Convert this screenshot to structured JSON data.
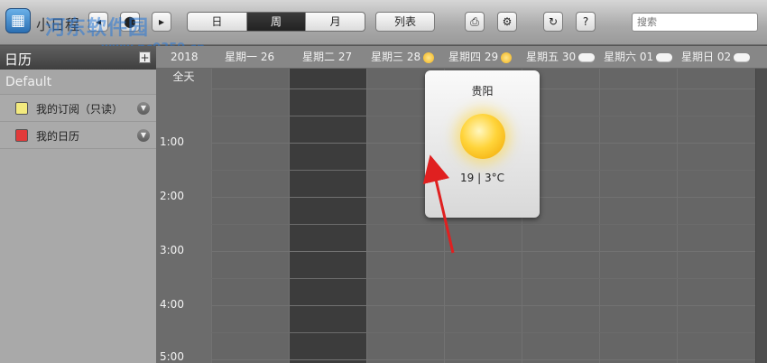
{
  "app": {
    "title": "小日程",
    "logo_icon": "calendar-logo-icon"
  },
  "toolbar": {
    "nav_buttons": [
      "back-icon",
      "location-pin-icon",
      "forward-icon"
    ],
    "views": [
      {
        "label": "日",
        "active": false
      },
      {
        "label": "周",
        "active": true
      },
      {
        "label": "月",
        "active": false
      }
    ],
    "list_label": "列表",
    "print_icon": "printer-icon",
    "settings_icon": "gear-icon",
    "sync_icon": "refresh-icon",
    "help_label": "?",
    "search_placeholder": "搜索"
  },
  "watermark": {
    "text": "河东软件园",
    "url": "www.pc0359.cn"
  },
  "sidebar": {
    "title": "日历",
    "add_label": "+",
    "section": "Default",
    "calendars": [
      {
        "label": "我的订阅（只读）",
        "color": "#f3ea7e"
      },
      {
        "label": "我的日历",
        "color": "#e23a3a"
      }
    ]
  },
  "calendar": {
    "year": "2018",
    "days": [
      {
        "label": "星期一 26",
        "weather": ""
      },
      {
        "label": "星期二 27",
        "weather": "",
        "today": true
      },
      {
        "label": "星期三 28",
        "weather": "sun-icon"
      },
      {
        "label": "星期四 29",
        "weather": "sun-icon"
      },
      {
        "label": "星期五 30",
        "weather": "cloud-icon"
      },
      {
        "label": "星期六 01",
        "weather": "cloud-icon"
      },
      {
        "label": "星期日 02",
        "weather": "cloud-icon"
      }
    ],
    "allday_label": "全天",
    "times": [
      "1:00",
      "2:00",
      "3:00",
      "4:00",
      "5:00"
    ]
  },
  "weather_popup": {
    "city": "贵阳",
    "icon": "sun-icon",
    "temperature": "19 | 3°C"
  },
  "colors": {
    "today_column": "#3c3c3c",
    "accent_arrow": "#e02020"
  }
}
